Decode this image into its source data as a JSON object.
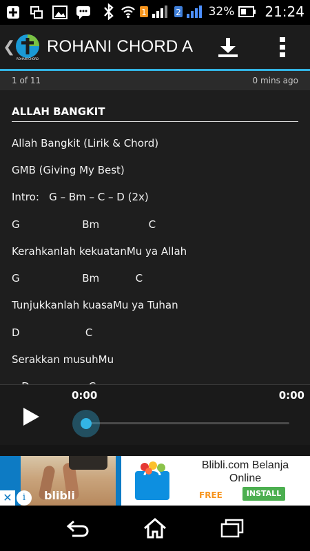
{
  "status_bar": {
    "battery_percent": "32%",
    "time": "21:24",
    "sim1": "1",
    "sim2": "2"
  },
  "action_bar": {
    "title": "ROHANI CHORD A",
    "back_glyph": "❮",
    "logo_caption": "ROHANI CHORD"
  },
  "page_info": {
    "position": "1 of 11",
    "updated": "0 mins ago"
  },
  "song": {
    "title": "ALLAH BANGKIT",
    "lines": [
      "Allah Bangkit (Lirik & Chord)",
      "GMB (Giving My Best)",
      "Intro:   G – Bm – C – D (2x)",
      "G                   Bm               C",
      "Kerahkanlah kekuatanMu ya Allah",
      "G                   Bm           C",
      "Tunjukkanlah kuasaMu ya Tuhan",
      "D                    C",
      "Serakkan musuhMu",
      "   D                  C"
    ]
  },
  "player": {
    "current_time": "0:00",
    "total_time": "0:00",
    "progress": 0
  },
  "ad": {
    "close_glyph": "✕",
    "info_glyph": "i",
    "image_brand": "blibli",
    "headline": "Blibli.com Belanja Online",
    "free_label": "FREE",
    "install_label": "INSTALL"
  },
  "colors": {
    "accent": "#33b5e5",
    "action_bar": "#1c1c1c",
    "content_bg": "#1e1e1e",
    "ad_blue": "#0d7bc4",
    "install_green": "#4caf50",
    "free_orange": "#f7941d"
  },
  "icons": {
    "status_left": [
      "add-box-icon",
      "multi-window-icon",
      "image-icon",
      "chat-icon"
    ],
    "status_right": [
      "bluetooth-icon",
      "wifi-icon",
      "sim1-signal-icon",
      "sim2-signal-icon",
      "battery-icon"
    ],
    "action": [
      "download-icon",
      "overflow-menu-icon"
    ],
    "nav": [
      "back-icon",
      "home-icon",
      "recent-apps-icon"
    ]
  }
}
